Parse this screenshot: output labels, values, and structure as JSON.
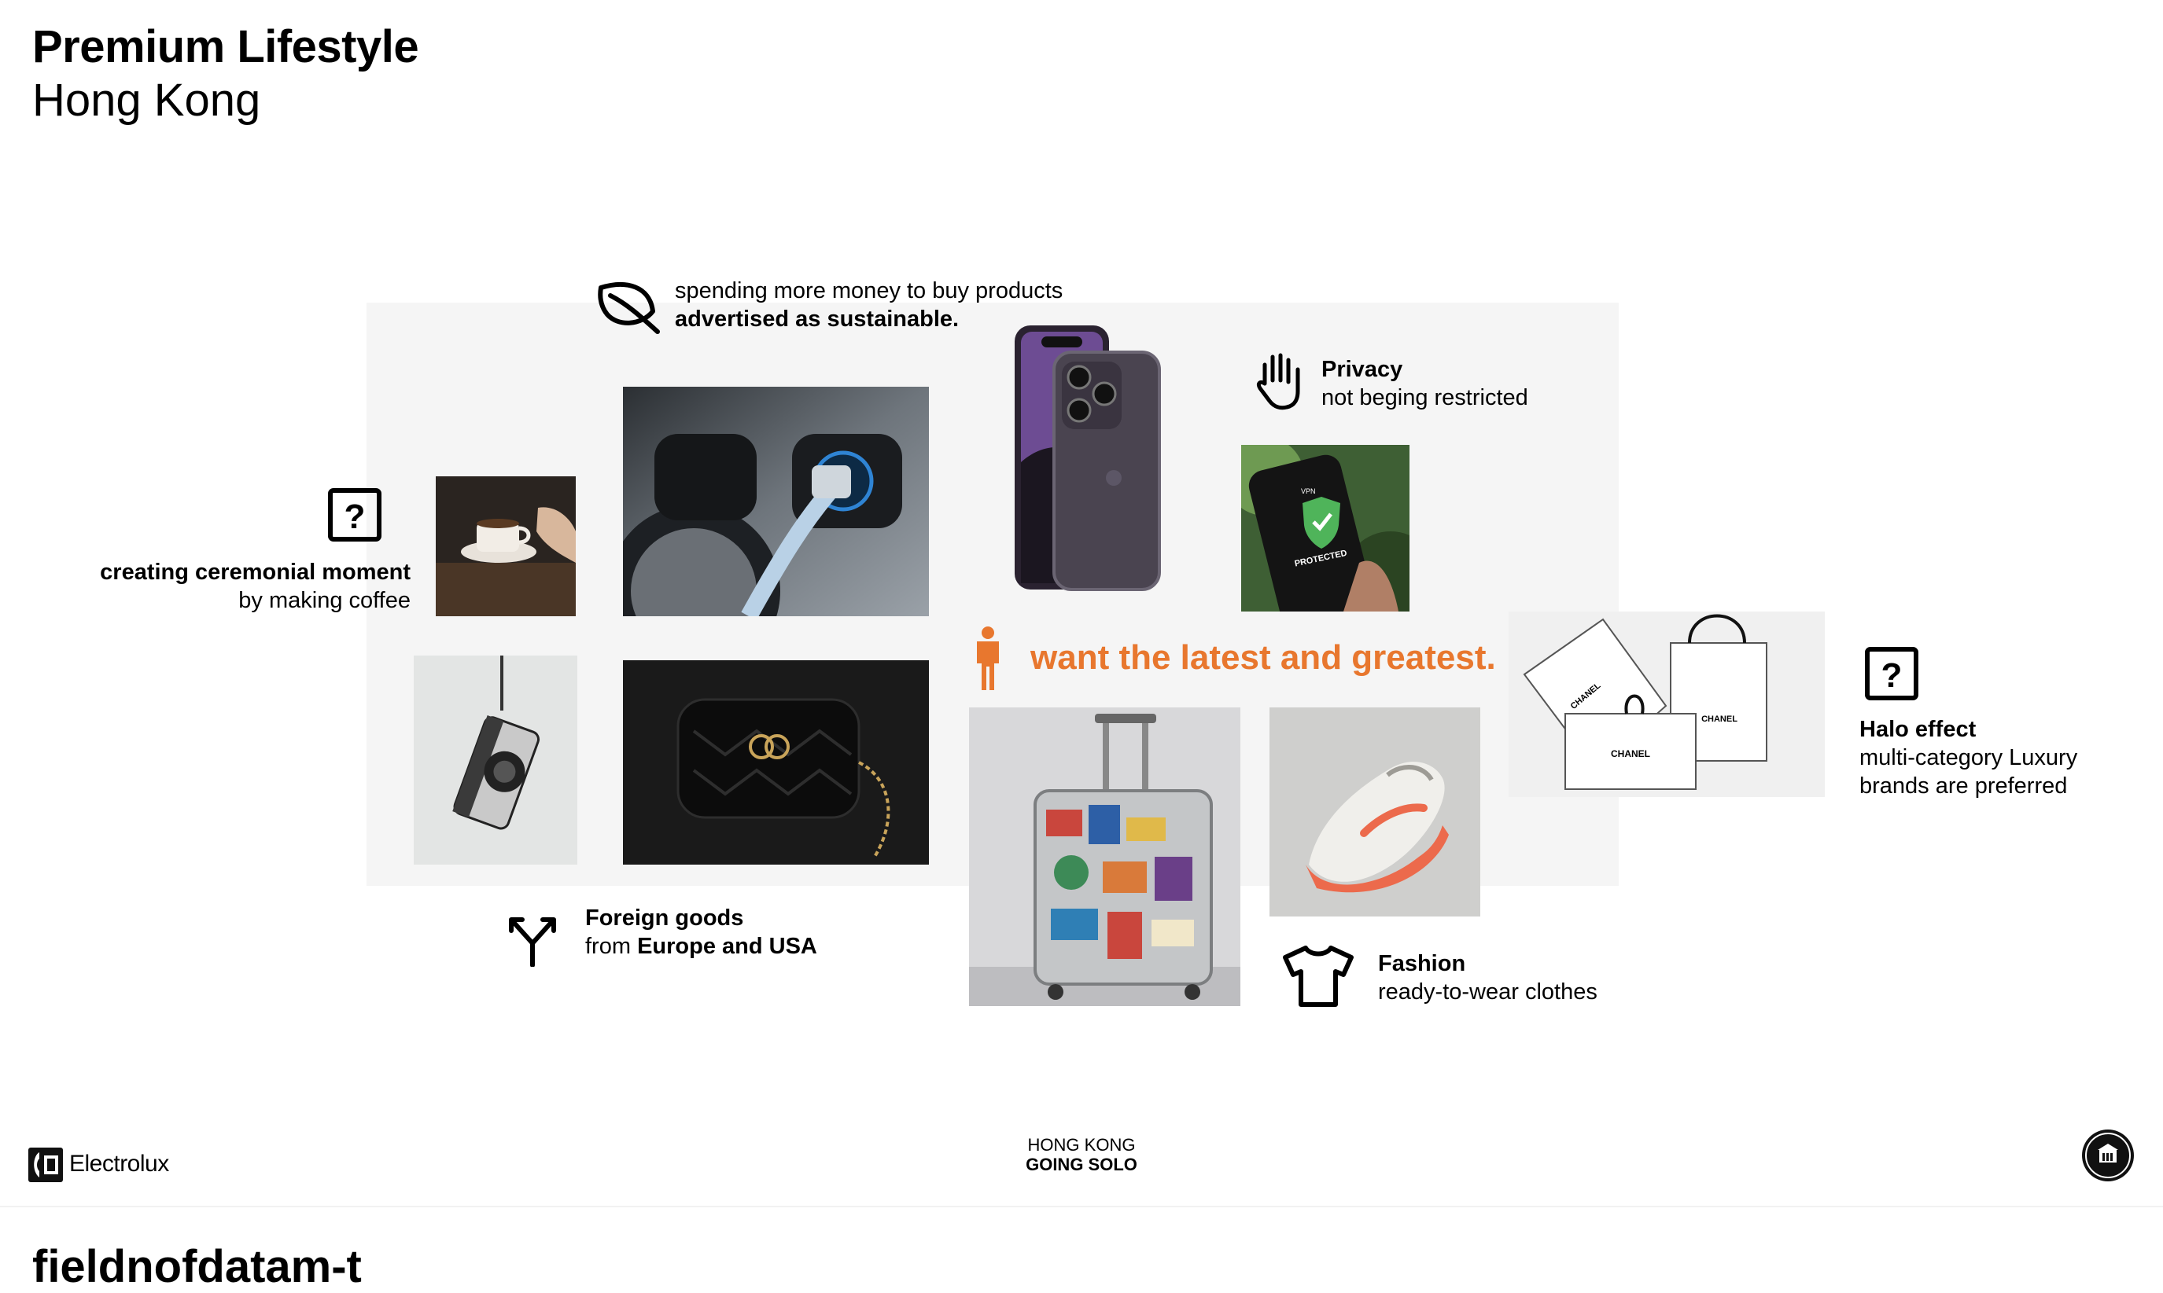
{
  "slide": {
    "title": "Premium Lifestyle",
    "subtitle": "Hong Kong"
  },
  "captions": {
    "sustainable_line1": "spending more money to buy products",
    "sustainable_line2": "advertised as sustainable.",
    "privacy_title": "Privacy",
    "privacy_text": "not beging restricted",
    "coffee_title": "creating ceremonial moment",
    "coffee_text": "by making coffee",
    "latest": "want the latest and greatest.",
    "halo_title": "Halo effect",
    "halo_line1": "multi-category Luxury",
    "halo_line2": "brands are preferred",
    "foreign_title": "Foreign goods",
    "foreign_prefix": "from",
    "foreign_bold": "Europe and USA",
    "fashion_title": "Fashion",
    "fashion_text": "ready-to-wear clothes"
  },
  "photos": {
    "vpn_label1": "VPN",
    "vpn_label2": "PROTECTED",
    "chanel": "CHANEL"
  },
  "icons": [
    "leaf-icon",
    "hand-stop-icon",
    "question-box-icon",
    "person-icon",
    "split-arrow-icon",
    "tshirt-icon",
    "electrolux-logo-icon",
    "university-seal-icon"
  ],
  "colors": {
    "accent": "#e8772e",
    "panel": "#f5f5f5"
  },
  "footer": {
    "brand": "Electrolux",
    "center_line1": "HONG KONG",
    "center_line2": "GOING SOLO",
    "next_slide_peek": "fieldnofdatam-t"
  }
}
